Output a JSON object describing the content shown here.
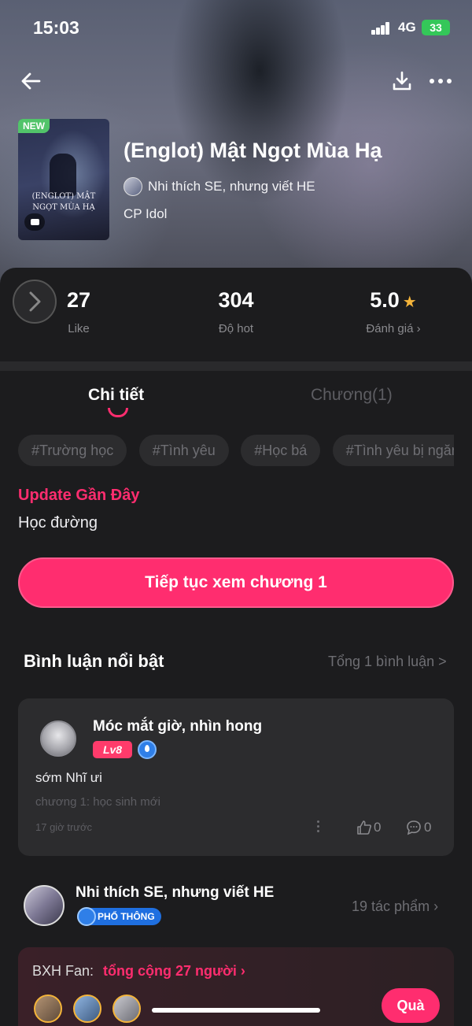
{
  "status_bar": {
    "time": "15:03",
    "network": "4G",
    "battery": "33"
  },
  "book": {
    "badge": "NEW",
    "cover_title": "(ENGLOT) MẬT NGỌT MÙA HẠ",
    "title": "(Englot) Mật Ngọt Mùa Hạ",
    "author": "Nhi thích SE, nhưng viết HE",
    "category": "CP Idol"
  },
  "stats": {
    "likes": {
      "value": "27",
      "label": "Like"
    },
    "hot": {
      "value": "304",
      "label": "Độ hot"
    },
    "rating": {
      "value": "5.0",
      "label": "Đánh giá ›"
    }
  },
  "tabs": {
    "detail": "Chi tiết",
    "chapters": "Chương(1)"
  },
  "tags": [
    "#Trường học",
    "#Tình yêu",
    "#Học bá",
    "#Tình yêu bị ngăn cấm"
  ],
  "update": {
    "heading": "Update Gần Đây",
    "text": "Học đường"
  },
  "continue_button": "Tiếp tục xem chương 1",
  "comments": {
    "heading": "Bình luận nổi bật",
    "total": "Tổng 1 bình luận >",
    "items": [
      {
        "user": "Móc mắt giờ, nhìn hong",
        "level": "Lv8",
        "text": "sớm Nhĩ ưi",
        "chapter": "chương 1: học sinh mới",
        "time": "17 giờ trước",
        "likes": "0",
        "replies": "0"
      }
    ]
  },
  "author_panel": {
    "name": "Nhi thích SE, nhưng viết HE",
    "rank": "PHỔ THÔNG",
    "works": "19 tác phẩm ›"
  },
  "fans": {
    "label": "BXH Fan:",
    "total": "tổng cộng 27 người ›",
    "gift_button": "Quà"
  },
  "colors": {
    "accent": "#ff2d6f",
    "background": "#1c1c1e",
    "card": "#2c2c2e",
    "star": "#f4b43a",
    "battery": "#34c759"
  }
}
